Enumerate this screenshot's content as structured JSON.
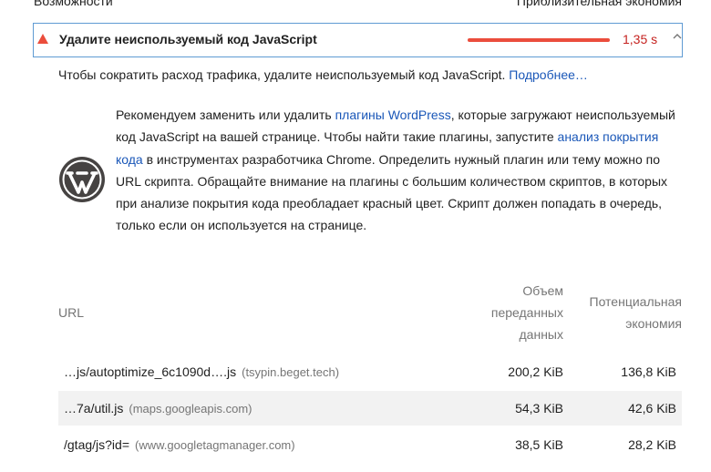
{
  "header": {
    "section": "Возможности",
    "savings_col": "Приблизительная экономия"
  },
  "audit": {
    "title": "Удалите неиспользуемый код JavaScript",
    "value": "1,35 s",
    "bar_fraction": 1.0,
    "color": "#eb4d3c",
    "description": "Чтобы сократить расход трафика, удалите неиспользуемый код JavaScript.",
    "more_link": "Подробнее…"
  },
  "wordpress": {
    "t1": "Рекомендуем заменить или удалить ",
    "link1": "плагины WordPress",
    "t2": ", которые загружают неиспользуемый код JavaScript на вашей странице. Чтобы найти такие плагины, запустите ",
    "link2": "анализ покрытия кода",
    "t3": " в инструментах разработчика Chrome. Определить нужный плагин или тему можно по URL скрипта. Обращайте внимание на плагины с большим количеством скриптов, в которых при анализе покрытия кода преобладает красный цвет. Скрипт должен попадать в очередь, только если он используется на странице."
  },
  "table": {
    "headers": {
      "url": "URL",
      "size": "Объем переданных данных",
      "savings": "Потенциальная экономия"
    },
    "rows": [
      {
        "url": "…js/autoptimize_6c1090d….js",
        "host": "(tsypin.beget.tech)",
        "size": "200,2 KiB",
        "savings": "136,8 KiB"
      },
      {
        "url": "…7a/util.js",
        "host": "(maps.googleapis.com)",
        "size": "54,3 KiB",
        "savings": "42,6 KiB"
      },
      {
        "url": "/gtag/js?id=",
        "host": "(www.googletagmanager.com)",
        "size": "38,5 KiB",
        "savings": "28,2 KiB"
      }
    ]
  }
}
